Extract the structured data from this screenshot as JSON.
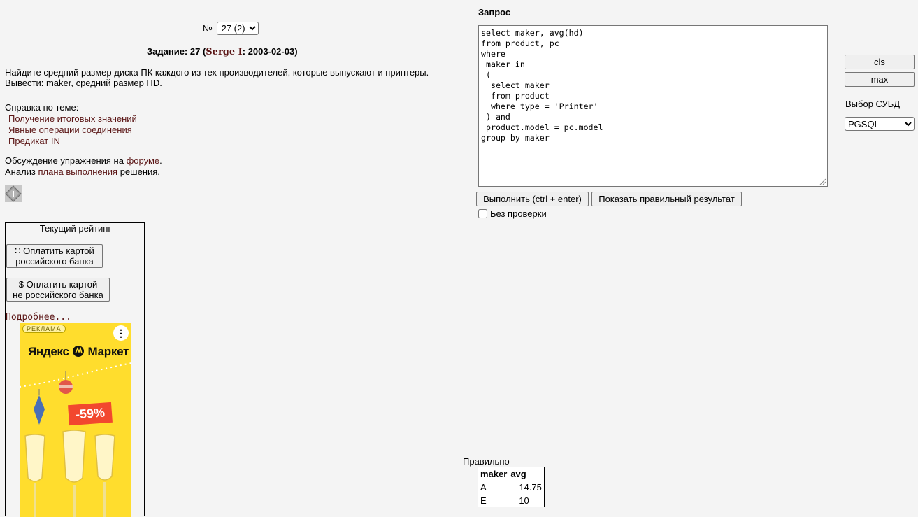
{
  "task_selector": {
    "number_sign": "№",
    "selected": "27 (2)"
  },
  "task": {
    "title_prefix": "Задание: 27 (",
    "author": "Serge I",
    "title_suffix": ": 2003-02-03)",
    "text": "Найдите средний размер диска ПК каждого из тех производителей, которые выпускают и принтеры. Вывести: maker, средний размер HD."
  },
  "help": {
    "heading": "Справка по теме:",
    "links": [
      "Получение итоговых значений",
      "Явные операции соединения",
      "Предикат IN"
    ]
  },
  "forum": {
    "line1_prefix": "Обсуждение упражнения на ",
    "line1_link": "форуме",
    "line1_suffix": ".",
    "line2_prefix": "Анализ ",
    "line2_link": "плана выполнения",
    "line2_suffix": " решения."
  },
  "rating": {
    "title": "Текущий рейтинг",
    "pay_ru_line1": "∷ Оплатить картой",
    "pay_ru_line2": "российского банка",
    "pay_foreign_line1": "$ Оплатить картой",
    "pay_foreign_line2": "не российского банка",
    "more": "Подробнее..."
  },
  "ad": {
    "label": "РЕКЛАМА",
    "brand": "Яндекс",
    "brand_suffix": "Маркет",
    "discount": "-59%",
    "menu": "⋮"
  },
  "query": {
    "label": "Запрос",
    "text": "select maker, avg(hd)\nfrom product, pc\nwhere\n maker in\n (\n  select maker\n  from product\n  where type = 'Printer'\n ) and\n product.model = pc.model\ngroup by maker"
  },
  "buttons": {
    "run": "Выполнить (ctrl + enter)",
    "show_correct": "Показать правильный результат",
    "no_check": "Без проверки",
    "cls": "cls",
    "max": "max"
  },
  "dbms": {
    "label": "Выбор СУБД",
    "selected": "PGSQL"
  },
  "result": {
    "label": "Правильно",
    "columns": [
      "maker",
      "avg"
    ],
    "rows": [
      [
        "A",
        "14.75"
      ],
      [
        "E",
        "10"
      ]
    ]
  },
  "colors": {
    "background": "#f4f4f4",
    "link": "#5a1414",
    "ad_yellow": "#ffdd2d",
    "ad_discount": "#f2482e"
  }
}
